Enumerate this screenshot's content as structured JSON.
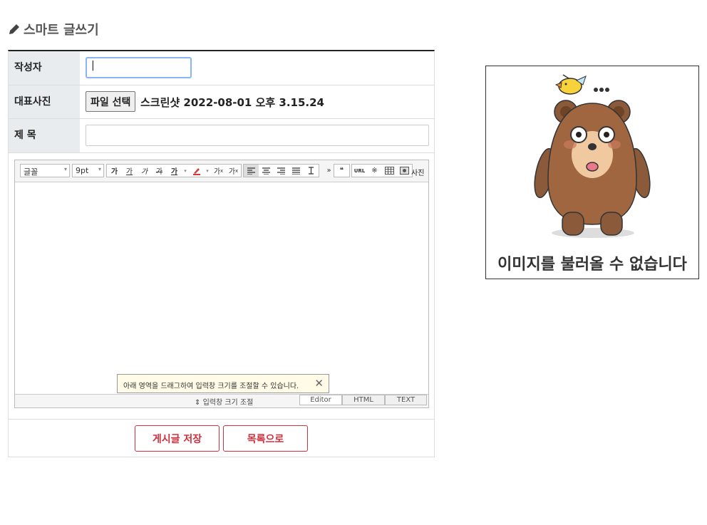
{
  "heading": {
    "icon": "pencil-icon",
    "title": "스마트 글쓰기"
  },
  "form": {
    "author": {
      "label": "작성자",
      "value": "|"
    },
    "photo": {
      "label": "대표사진",
      "button": "파일 선택",
      "file_name": "스크린샷 2022-08-01 오후 3.15.24"
    },
    "subject": {
      "label": "제 목",
      "value": ""
    }
  },
  "editor": {
    "font_select": "글꼴",
    "size_select": "9pt",
    "format_buttons": [
      "가",
      "가",
      "가",
      "가",
      "가"
    ],
    "superscript": "가",
    "subscript": "가",
    "more": "»",
    "quote": "❝",
    "url": "URL",
    "special_char": "※",
    "table_icon": "table-icon",
    "photo_label": "사진",
    "tooltip": "아래 영역을 드래그하여 입력창 크기를 조절할 수 있습니다.",
    "resize_label": "입력창 크기 조절",
    "modes": [
      "Editor",
      "HTML",
      "TEXT"
    ]
  },
  "buttons": {
    "save": "게시글 저장",
    "list": "목록으로"
  },
  "image_box": {
    "caption": "이미지를 불러올 수 없습니다"
  },
  "colors": {
    "accent": "#d0303c",
    "label_bg": "#e9ecef",
    "focus": "#8ab4f8"
  }
}
